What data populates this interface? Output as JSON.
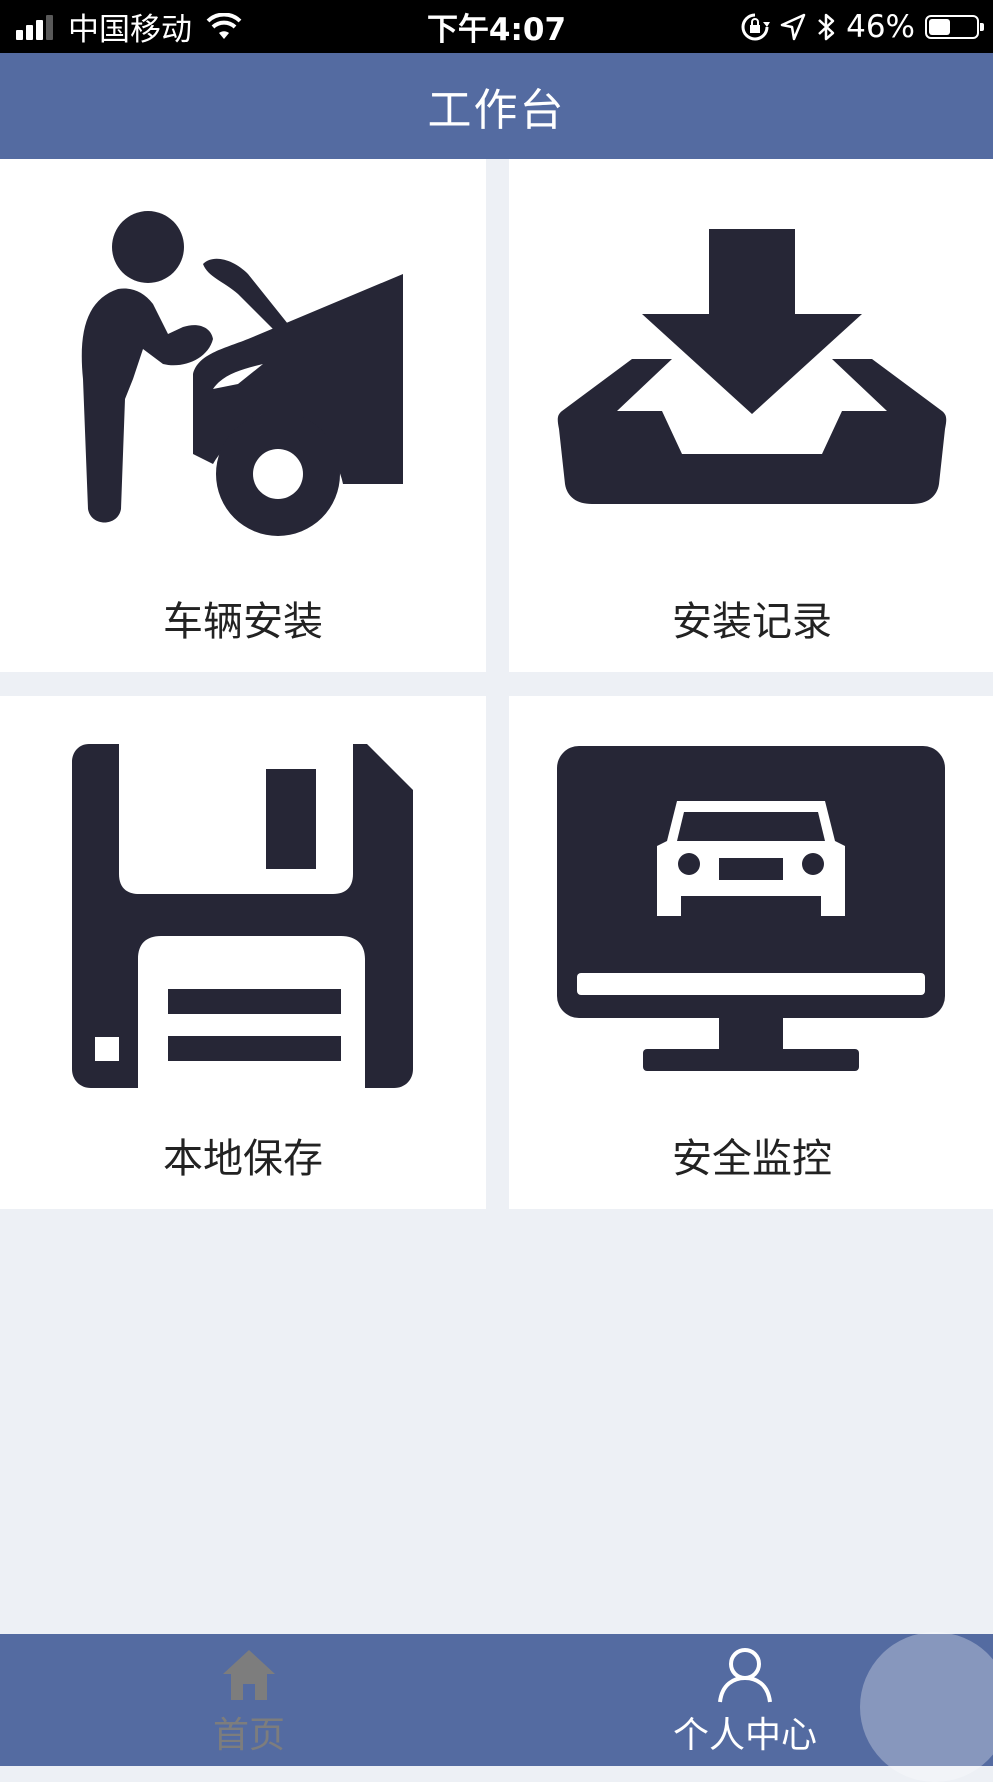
{
  "status_bar": {
    "carrier": "中国移动",
    "time": "下午4:07",
    "battery_percent": "46%",
    "battery_level": 0.46
  },
  "header": {
    "title": "工作台"
  },
  "tiles": [
    {
      "label": "车辆安装",
      "icon": "car-repair-icon"
    },
    {
      "label": "安装记录",
      "icon": "inbox-download-icon"
    },
    {
      "label": "本地保存",
      "icon": "floppy-disk-icon"
    },
    {
      "label": "安全监控",
      "icon": "monitor-car-icon"
    }
  ],
  "tabbar": {
    "home_label": "首页",
    "profile_label": "个人中心"
  },
  "colors": {
    "header": "#546ba1",
    "icon": "#262636",
    "background": "#edf0f5",
    "tab_inactive": "#7d7d7d",
    "tab_active": "#ffffff"
  }
}
